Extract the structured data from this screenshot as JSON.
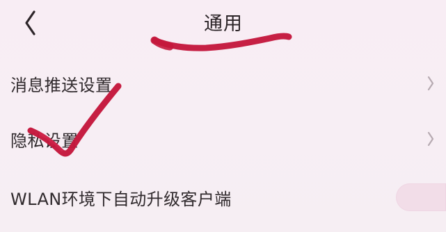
{
  "header": {
    "title": "通用"
  },
  "settings": {
    "items": [
      {
        "label": "消息推送设置"
      },
      {
        "label": "隐私设置"
      },
      {
        "label": "WLAN环境下自动升级客户端"
      }
    ]
  },
  "colors": {
    "background": "#f7edf3",
    "text": "#302a2d",
    "annotation": "#c4173c",
    "toggle": "#f2dde8"
  },
  "icons": {
    "back": "chevron-left-icon",
    "row_arrow": "chevron-right-icon"
  }
}
